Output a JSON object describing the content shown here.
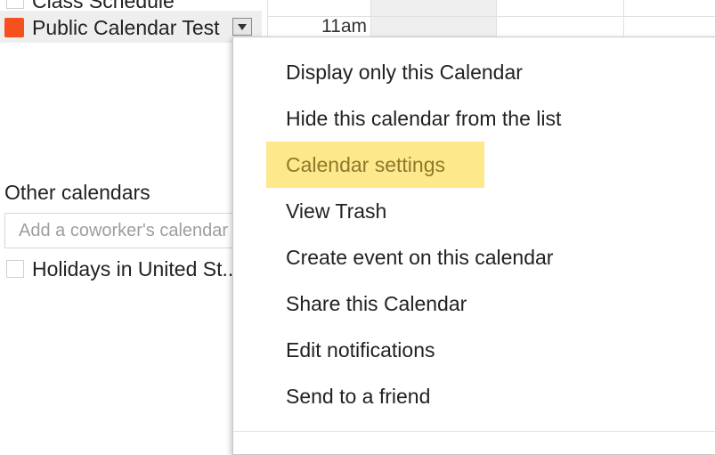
{
  "my_calendars": [
    {
      "label": "Class Schedule",
      "color": null
    },
    {
      "label": "Public Calendar Test",
      "color": "#f4511e"
    }
  ],
  "other_calendars": {
    "title": "Other calendars",
    "add_placeholder": "Add a coworker's calendar",
    "items": [
      {
        "label": "Holidays in United St..."
      }
    ]
  },
  "grid": {
    "time_label": "11am"
  },
  "menu": {
    "items": [
      {
        "label": "Display only this Calendar",
        "highlighted": false
      },
      {
        "label": "Hide this calendar from the list",
        "highlighted": false
      },
      {
        "label": "Calendar settings",
        "highlighted": true
      },
      {
        "label": "View Trash",
        "highlighted": false
      },
      {
        "label": "Create event on this calendar",
        "highlighted": false
      },
      {
        "label": "Share this Calendar",
        "highlighted": false
      },
      {
        "label": "Edit notifications",
        "highlighted": false
      },
      {
        "label": "Send to a friend",
        "highlighted": false
      }
    ],
    "highlight_color": "#fde98b"
  },
  "icons": {
    "dropdown": "chevron-down-icon"
  }
}
